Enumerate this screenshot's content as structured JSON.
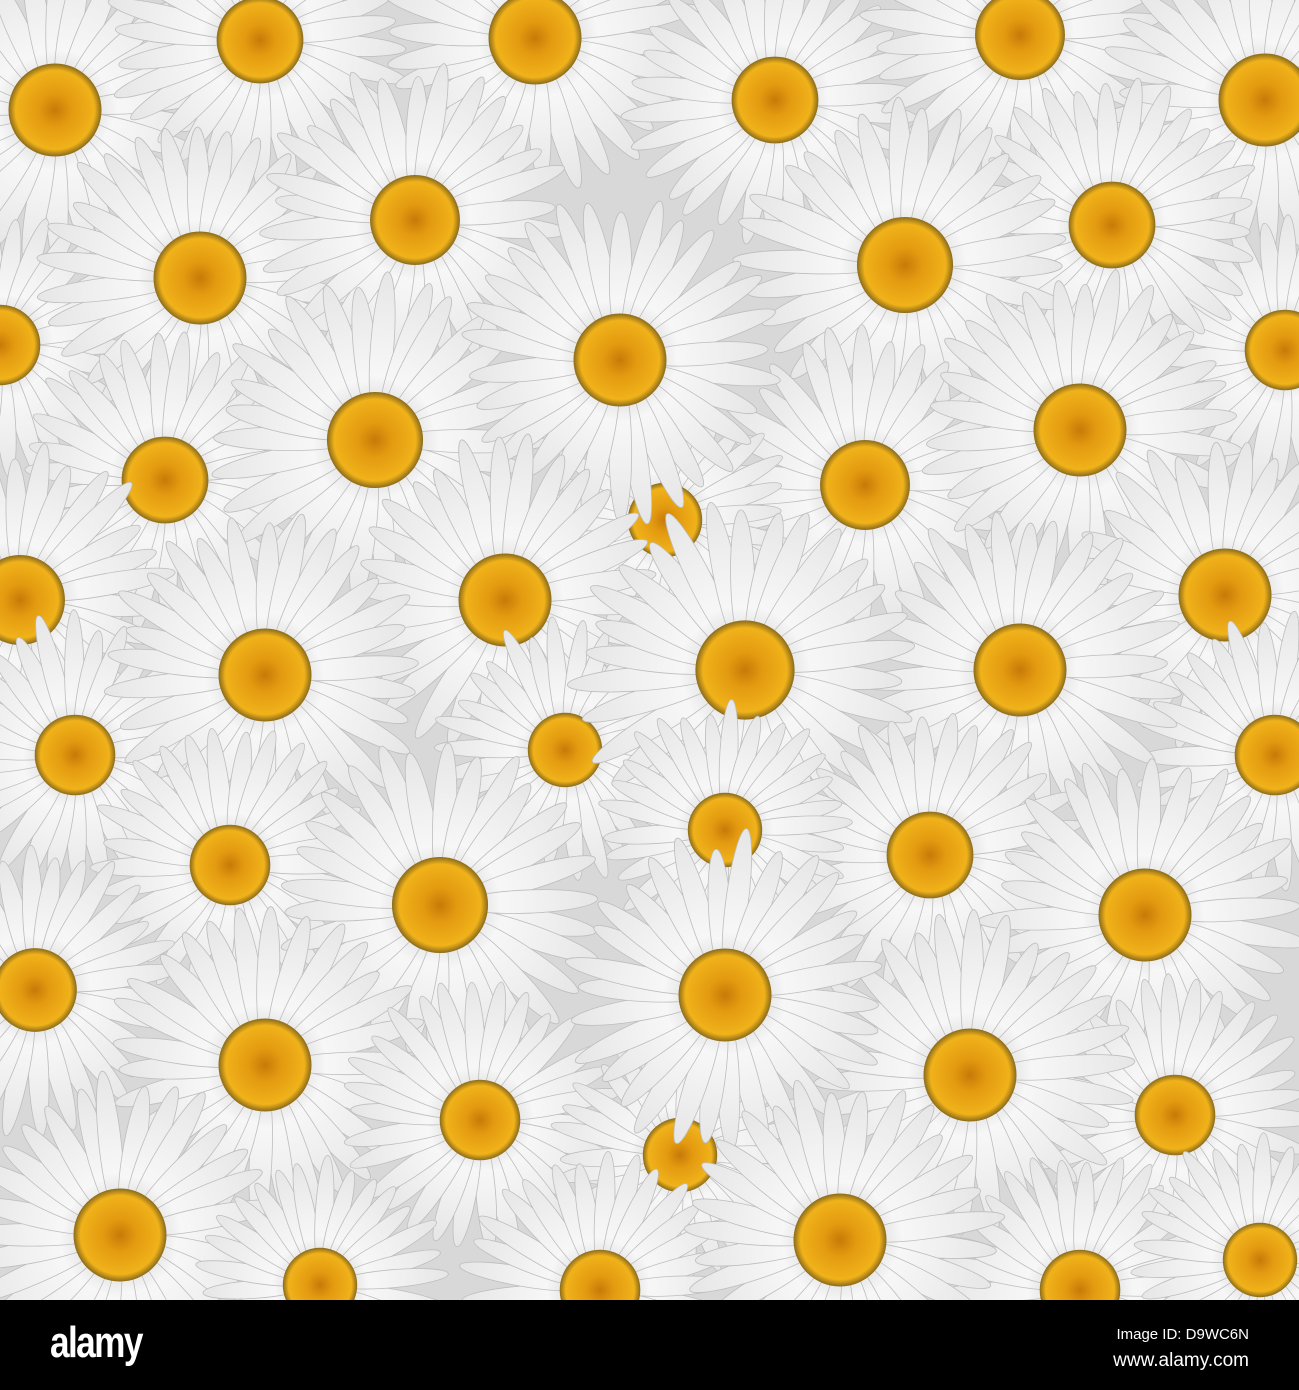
{
  "photo": {
    "subject": "daisies",
    "petal_color": "#f4f4f4",
    "center_color": "#e8a512"
  },
  "footer": {
    "logo": "alamy",
    "image_id": "Image ID: D9WC6N",
    "website": "www.alamy.com"
  }
}
